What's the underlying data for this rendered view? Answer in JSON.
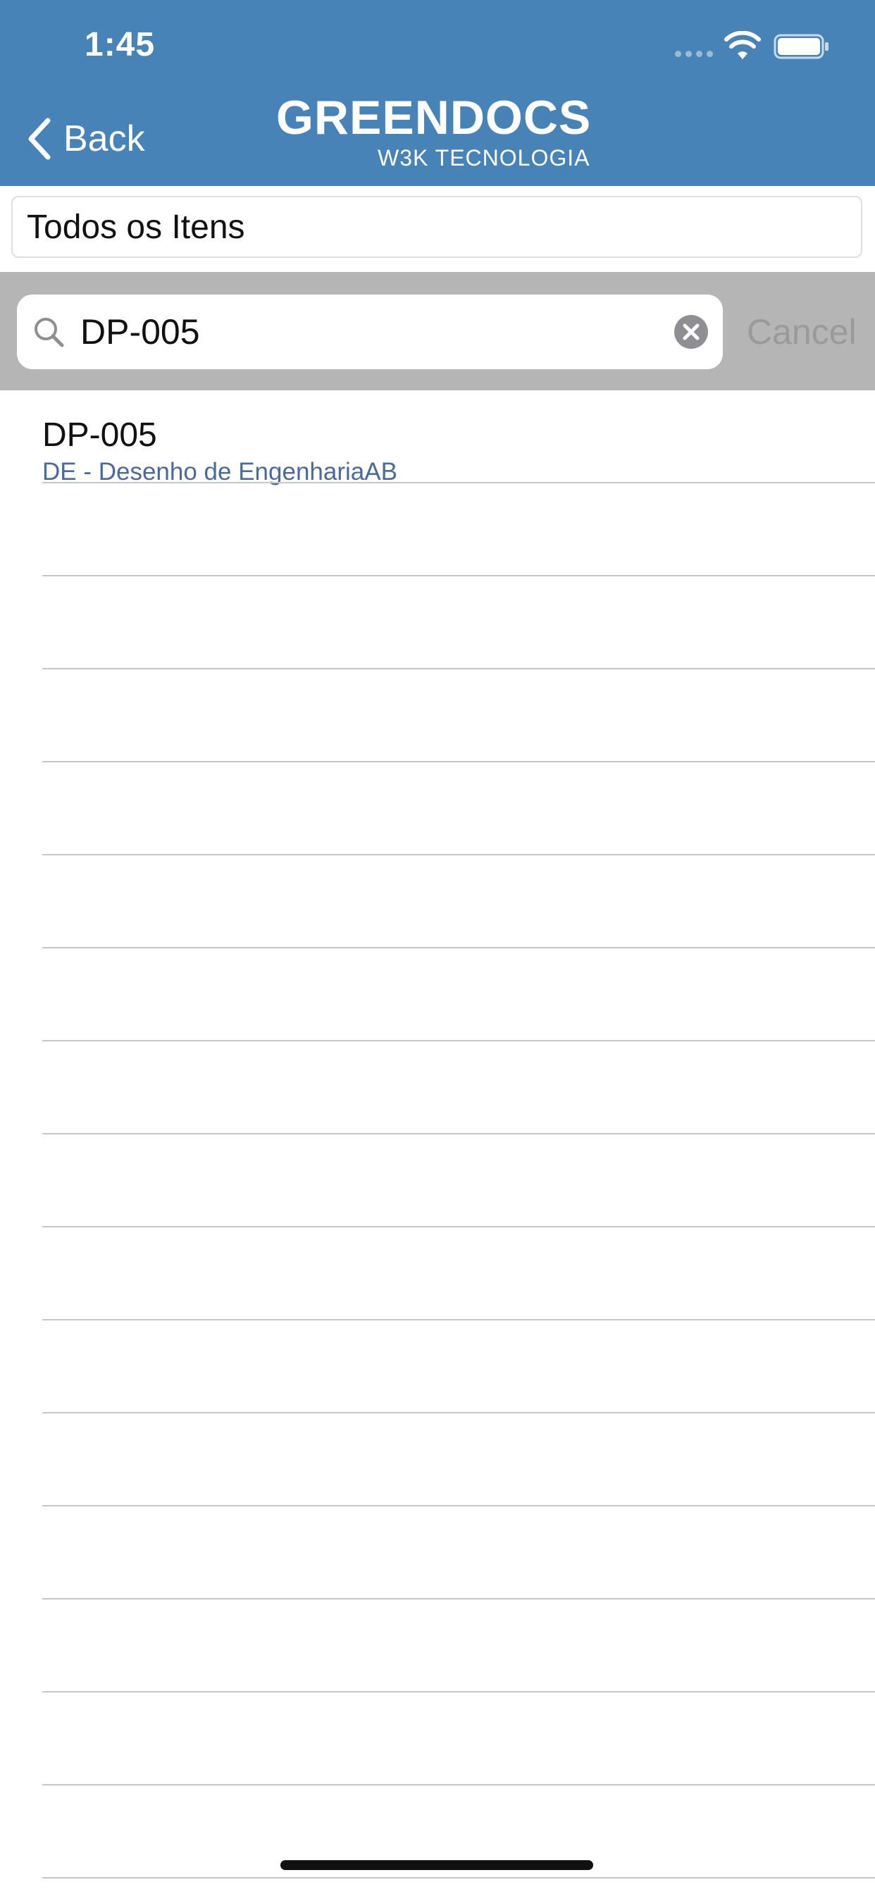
{
  "status_bar": {
    "time": "1:45"
  },
  "nav": {
    "back_label": "Back",
    "brand_name": "GREENDOCS",
    "brand_sub": "W3K TECNOLOGIA",
    "color": "#4783b7"
  },
  "filter": {
    "label": "Todos os Itens"
  },
  "search": {
    "value": "DP-005",
    "cancel_label": "Cancel"
  },
  "results": [
    {
      "title": "DP-005",
      "subtitle": "DE - Desenho de EngenhariaAB"
    }
  ]
}
